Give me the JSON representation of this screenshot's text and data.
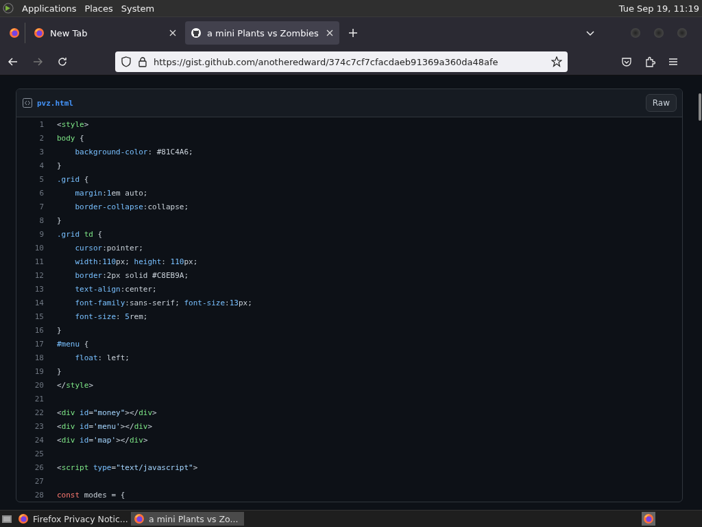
{
  "top_panel": {
    "menus": [
      "Applications",
      "Places",
      "System"
    ],
    "clock": "Tue Sep 19, 11:19"
  },
  "tabs": [
    {
      "title": "New Tab",
      "selected": false
    },
    {
      "title": "a mini Plants vs Zombies",
      "selected": true
    }
  ],
  "nav": {
    "url": "https://gist.github.com/anotheredward/374c7cf7cfacdaeb91369a360da48afe",
    "forward_disabled": true
  },
  "file": {
    "name": "pvz.html",
    "raw_button": "Raw",
    "lines": [
      {
        "number": "1",
        "indent": false,
        "tokens": [
          {
            "kind": "plain",
            "text": "<"
          },
          {
            "kind": "tag",
            "text": "style"
          },
          {
            "kind": "plain",
            "text": ">"
          }
        ]
      },
      {
        "number": "2",
        "indent": false,
        "tokens": [
          {
            "kind": "tag",
            "text": "body"
          },
          {
            "kind": "plain",
            "text": " {"
          }
        ]
      },
      {
        "number": "3",
        "indent": true,
        "tokens": [
          {
            "kind": "prop",
            "text": "background-color"
          },
          {
            "kind": "plain",
            "text": ": #81C4A6;"
          }
        ]
      },
      {
        "number": "4",
        "indent": false,
        "tokens": [
          {
            "kind": "plain",
            "text": "}"
          }
        ]
      },
      {
        "number": "5",
        "indent": false,
        "tokens": [
          {
            "kind": "prop",
            "text": ".grid"
          },
          {
            "kind": "plain",
            "text": " {"
          }
        ]
      },
      {
        "number": "6",
        "indent": true,
        "tokens": [
          {
            "kind": "prop",
            "text": "margin"
          },
          {
            "kind": "plain",
            "text": ":"
          },
          {
            "kind": "number",
            "text": "1"
          },
          {
            "kind": "plain",
            "text": "em auto;"
          }
        ]
      },
      {
        "number": "7",
        "indent": true,
        "tokens": [
          {
            "kind": "prop",
            "text": "border-collapse"
          },
          {
            "kind": "plain",
            "text": ":collapse;"
          }
        ]
      },
      {
        "number": "8",
        "indent": false,
        "tokens": [
          {
            "kind": "plain",
            "text": "}"
          }
        ]
      },
      {
        "number": "9",
        "indent": false,
        "tokens": [
          {
            "kind": "prop",
            "text": ".grid"
          },
          {
            "kind": "tag",
            "text": " td"
          },
          {
            "kind": "plain",
            "text": " {"
          }
        ]
      },
      {
        "number": "10",
        "indent": true,
        "tokens": [
          {
            "kind": "prop",
            "text": "cursor"
          },
          {
            "kind": "plain",
            "text": ":pointer;"
          }
        ]
      },
      {
        "number": "11",
        "indent": true,
        "tokens": [
          {
            "kind": "prop",
            "text": "width"
          },
          {
            "kind": "plain",
            "text": ":"
          },
          {
            "kind": "number",
            "text": "110"
          },
          {
            "kind": "plain",
            "text": "px; "
          },
          {
            "kind": "prop",
            "text": "height"
          },
          {
            "kind": "plain",
            "text": ": "
          },
          {
            "kind": "number",
            "text": "110"
          },
          {
            "kind": "plain",
            "text": "px;"
          }
        ]
      },
      {
        "number": "12",
        "indent": true,
        "tokens": [
          {
            "kind": "prop",
            "text": "border"
          },
          {
            "kind": "plain",
            "text": ":2px solid #C8EB9A;"
          }
        ]
      },
      {
        "number": "13",
        "indent": true,
        "tokens": [
          {
            "kind": "prop",
            "text": "text-align"
          },
          {
            "kind": "plain",
            "text": ":center;"
          }
        ]
      },
      {
        "number": "14",
        "indent": true,
        "tokens": [
          {
            "kind": "prop",
            "text": "font-family"
          },
          {
            "kind": "plain",
            "text": ":sans-serif; "
          },
          {
            "kind": "prop",
            "text": "font-size"
          },
          {
            "kind": "plain",
            "text": ":"
          },
          {
            "kind": "number",
            "text": "13"
          },
          {
            "kind": "plain",
            "text": "px;"
          }
        ]
      },
      {
        "number": "15",
        "indent": true,
        "tokens": [
          {
            "kind": "prop",
            "text": "font-size"
          },
          {
            "kind": "plain",
            "text": ": "
          },
          {
            "kind": "number",
            "text": "5"
          },
          {
            "kind": "plain",
            "text": "rem;"
          }
        ]
      },
      {
        "number": "16",
        "indent": false,
        "tokens": [
          {
            "kind": "plain",
            "text": "}"
          }
        ]
      },
      {
        "number": "17",
        "indent": false,
        "tokens": [
          {
            "kind": "prop",
            "text": "#menu"
          },
          {
            "kind": "plain",
            "text": " {"
          }
        ]
      },
      {
        "number": "18",
        "indent": true,
        "tokens": [
          {
            "kind": "prop",
            "text": "float"
          },
          {
            "kind": "plain",
            "text": ": left;"
          }
        ]
      },
      {
        "number": "19",
        "indent": false,
        "tokens": [
          {
            "kind": "plain",
            "text": "}"
          }
        ]
      },
      {
        "number": "20",
        "indent": false,
        "tokens": [
          {
            "kind": "plain",
            "text": "</"
          },
          {
            "kind": "tag",
            "text": "style"
          },
          {
            "kind": "plain",
            "text": ">"
          }
        ]
      },
      {
        "number": "21"
      },
      {
        "number": "22",
        "indent": false,
        "tokens": [
          {
            "kind": "plain",
            "text": "<"
          },
          {
            "kind": "tag",
            "text": "div"
          },
          {
            "kind": "prop",
            "text": " id"
          },
          {
            "kind": "plain",
            "text": "="
          },
          {
            "kind": "string",
            "text": "\"money\""
          },
          {
            "kind": "plain",
            "text": "></"
          },
          {
            "kind": "tag",
            "text": "div"
          },
          {
            "kind": "plain",
            "text": ">"
          }
        ]
      },
      {
        "number": "23",
        "indent": false,
        "tokens": [
          {
            "kind": "plain",
            "text": "<"
          },
          {
            "kind": "tag",
            "text": "div"
          },
          {
            "kind": "prop",
            "text": " id"
          },
          {
            "kind": "plain",
            "text": "="
          },
          {
            "kind": "string",
            "text": "'menu'"
          },
          {
            "kind": "plain",
            "text": "></"
          },
          {
            "kind": "tag",
            "text": "div"
          },
          {
            "kind": "plain",
            "text": ">"
          }
        ]
      },
      {
        "number": "24",
        "indent": false,
        "tokens": [
          {
            "kind": "plain",
            "text": "<"
          },
          {
            "kind": "tag",
            "text": "div"
          },
          {
            "kind": "prop",
            "text": " id"
          },
          {
            "kind": "plain",
            "text": "="
          },
          {
            "kind": "string",
            "text": "'map'"
          },
          {
            "kind": "plain",
            "text": "></"
          },
          {
            "kind": "tag",
            "text": "div"
          },
          {
            "kind": "plain",
            "text": ">"
          }
        ]
      },
      {
        "number": "25"
      },
      {
        "number": "26",
        "indent": false,
        "tokens": [
          {
            "kind": "plain",
            "text": "<"
          },
          {
            "kind": "tag",
            "text": "script"
          },
          {
            "kind": "prop",
            "text": " type"
          },
          {
            "kind": "plain",
            "text": "="
          },
          {
            "kind": "string",
            "text": "\"text/javascript\""
          },
          {
            "kind": "plain",
            "text": ">"
          }
        ]
      },
      {
        "number": "27"
      },
      {
        "number": "28",
        "indent": false,
        "tokens": [
          {
            "kind": "keyword",
            "text": "const"
          },
          {
            "kind": "plain",
            "text": " modes = {"
          }
        ]
      }
    ]
  },
  "taskbar": {
    "tasks": [
      {
        "title": "Firefox Privacy Notic...",
        "selected": false
      },
      {
        "title": "a mini Plants vs Zo...",
        "selected": true
      }
    ]
  }
}
